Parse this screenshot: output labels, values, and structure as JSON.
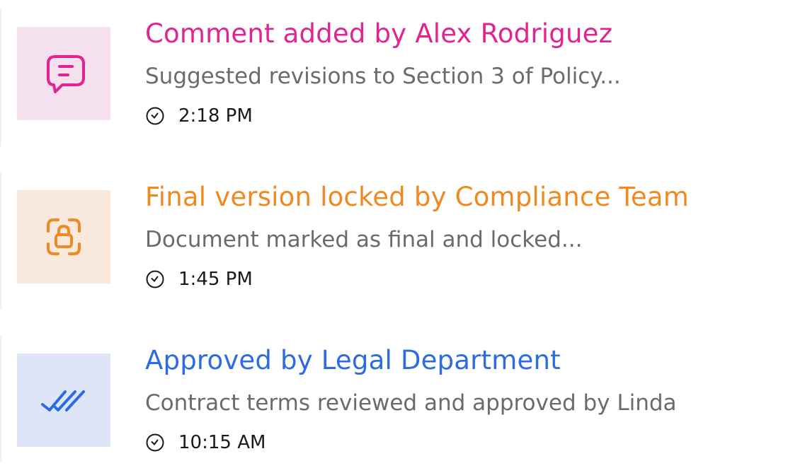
{
  "activity": [
    {
      "title": "Comment added by Alex Rodriguez",
      "description": "Suggested revisions to Section 3 of Policy...",
      "time": "2:18 PM",
      "icon": "comment-icon",
      "accent_color": "#e1248f",
      "tile_color": "#f5e1ee"
    },
    {
      "title": "Final version locked by Compliance Team",
      "description": "Document marked as final and locked...",
      "time": "1:45 PM",
      "icon": "lock-icon",
      "accent_color": "#ee8a22",
      "tile_color": "#f9e9dc"
    },
    {
      "title": "Approved by Legal Department",
      "description": "Contract terms reviewed and approved by Linda",
      "time": "10:15 AM",
      "icon": "double-check-icon",
      "accent_color": "#2c6be3",
      "tile_color": "#dde5f6"
    }
  ]
}
